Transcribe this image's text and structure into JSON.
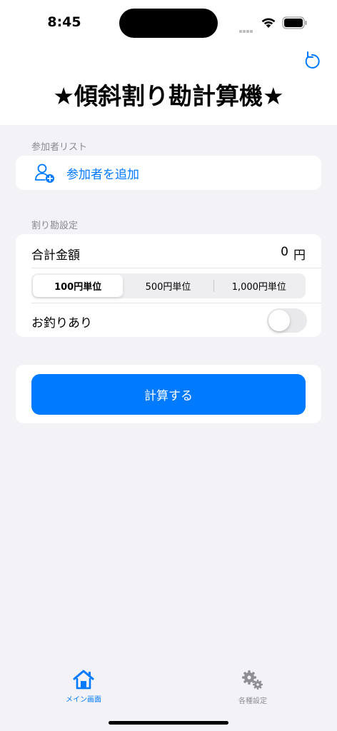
{
  "status_bar": {
    "time": "8:45"
  },
  "header": {
    "title": "★傾斜割り勘計算機★"
  },
  "participants": {
    "section_title": "参加者リスト",
    "add_label": "参加者を追加"
  },
  "settings": {
    "section_title": "割り勘設定",
    "total_label": "合計金額",
    "total_value": "0",
    "total_unit": "円",
    "rounding_options": [
      "100円単位",
      "500円単位",
      "1,000円単位"
    ],
    "rounding_selected": "100円単位",
    "change_label": "お釣りあり",
    "change_enabled": false
  },
  "calculate_label": "計算する",
  "tabs": [
    {
      "label": "メイン画面",
      "icon": "house-icon",
      "active": true
    },
    {
      "label": "各種設定",
      "icon": "gears-icon",
      "active": false
    }
  ],
  "colors": {
    "accent": "#007aff",
    "background": "#f2f2f7",
    "inactive": "#8e8e93"
  }
}
